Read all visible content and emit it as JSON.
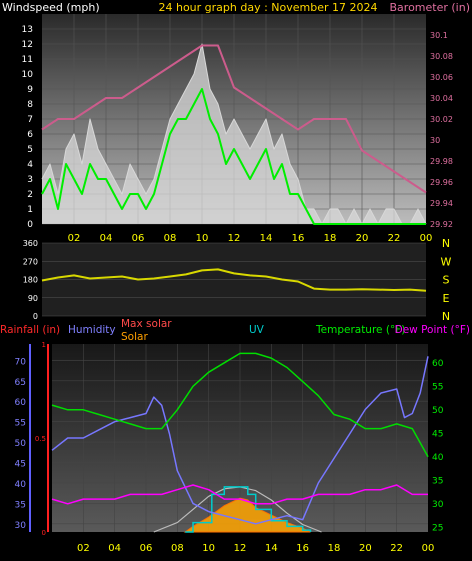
{
  "header": {
    "windspeed_label": "Windspeed (mph)",
    "title": "24 hour graph day : November 17 2024",
    "barometer_label": "Barometer (in)"
  },
  "bottom_header": {
    "rainfall": "Rainfall (in)",
    "humidity": "Humidity",
    "max_solar": "Max solar",
    "solar": "Solar",
    "uv": "UV",
    "temperature": "Temperature (°F)",
    "dew_point": "Dew Point (°F)"
  },
  "colors": {
    "windspeed": "#d8d8d8",
    "gust": "#00ee00",
    "barometer": "#cc5c8c",
    "direction": "#d8d800",
    "rainfall": "#ff2020",
    "humidity": "#7777ff",
    "temperature": "#00dd00",
    "dew_point": "#ff00ff",
    "max_solar": "#bbbbbb",
    "solar": "#ffa500",
    "uv": "#00cccc",
    "left_axis": "#ffff00",
    "compass": "#ffff00"
  },
  "chart_data": [
    {
      "type": "line",
      "title": "24 hour graph day : November 17 2024",
      "x_ticks": [
        "02",
        "04",
        "06",
        "08",
        "10",
        "12",
        "14",
        "16",
        "18",
        "20",
        "22",
        "00"
      ],
      "xlim": [
        0,
        24
      ],
      "left_axis": {
        "label": "Windspeed (mph)",
        "ylim": [
          0,
          14
        ],
        "ticks": [
          "0",
          "1",
          "2",
          "3",
          "4",
          "5",
          "6",
          "7",
          "8",
          "9",
          "10",
          "11",
          "12",
          "13"
        ]
      },
      "right_axis": {
        "label": "Barometer (in)",
        "ylim": [
          29.92,
          30.12
        ],
        "ticks": [
          "29.92",
          "29.94",
          "29.96",
          "29.98",
          "30",
          "30.02",
          "30.04",
          "30.06",
          "30.08",
          "30.1"
        ]
      },
      "series": [
        {
          "name": "Windspeed",
          "axis": "left",
          "x": [
            0,
            0.5,
            1,
            1.5,
            2,
            2.5,
            3,
            3.5,
            4,
            4.5,
            5,
            5.5,
            6,
            6.5,
            7,
            7.5,
            8,
            8.5,
            9,
            9.5,
            10,
            10.5,
            11,
            11.5,
            12,
            12.5,
            13,
            13.5,
            14,
            14.5,
            15,
            15.5,
            16,
            16.5,
            17,
            17.5,
            18,
            18.5,
            19,
            19.5,
            20,
            20.5,
            21,
            21.5,
            22,
            22.5,
            23,
            23.5,
            24
          ],
          "values": [
            3,
            4,
            2,
            5,
            6,
            4,
            7,
            5,
            4,
            3,
            2,
            4,
            3,
            2,
            3,
            5,
            7,
            8,
            9,
            10,
            12,
            9,
            8,
            6,
            7,
            6,
            5,
            6,
            7,
            5,
            6,
            4,
            3,
            1,
            1,
            0,
            1,
            1,
            0,
            1,
            0,
            1,
            0,
            1,
            1,
            0,
            0,
            1,
            0
          ]
        },
        {
          "name": "Gust",
          "axis": "left",
          "x": [
            0,
            0.5,
            1,
            1.5,
            2,
            2.5,
            3,
            3.5,
            4,
            4.5,
            5,
            5.5,
            6,
            6.5,
            7,
            7.5,
            8,
            8.5,
            9,
            9.5,
            10,
            10.5,
            11,
            11.5,
            12,
            12.5,
            13,
            13.5,
            14,
            14.5,
            15,
            15.5,
            16,
            16.5,
            17,
            17.5,
            18,
            18.5,
            19,
            19.5,
            20,
            20.5,
            21,
            21.5,
            22,
            22.5,
            23,
            23.5,
            24
          ],
          "values": [
            2,
            3,
            1,
            4,
            3,
            2,
            4,
            3,
            3,
            2,
            1,
            2,
            2,
            1,
            2,
            4,
            6,
            7,
            7,
            8,
            9,
            7,
            6,
            4,
            5,
            4,
            3,
            4,
            5,
            3,
            4,
            2,
            2,
            1,
            0,
            0,
            0,
            0,
            0,
            0,
            0,
            0,
            0,
            0,
            0,
            0,
            0,
            0,
            0
          ]
        },
        {
          "name": "Barometer",
          "axis": "right",
          "x": [
            0,
            1,
            2,
            3,
            4,
            5,
            6,
            7,
            8,
            9,
            10,
            11,
            12,
            13,
            14,
            15,
            16,
            17,
            18,
            19,
            20,
            21,
            22,
            23,
            24
          ],
          "values": [
            30.01,
            30.02,
            30.02,
            30.03,
            30.04,
            30.04,
            30.05,
            30.06,
            30.07,
            30.08,
            30.09,
            30.09,
            30.05,
            30.04,
            30.03,
            30.02,
            30.01,
            30.02,
            30.02,
            30.02,
            29.99,
            29.98,
            29.97,
            29.96,
            29.95
          ]
        }
      ]
    },
    {
      "type": "line",
      "x_ticks": [
        "02",
        "04",
        "06",
        "08",
        "10",
        "12",
        "14",
        "16",
        "18",
        "20",
        "22",
        "00"
      ],
      "xlim": [
        0,
        24
      ],
      "left_axis": {
        "ylim": [
          0,
          360
        ],
        "ticks": [
          "360",
          "270",
          "180",
          "90",
          "0"
        ]
      },
      "right_labels": [
        "N",
        "W",
        "S",
        "E",
        "N"
      ],
      "series": [
        {
          "name": "Wind direction",
          "x": [
            0,
            1,
            2,
            3,
            4,
            5,
            6,
            7,
            8,
            9,
            10,
            11,
            12,
            13,
            14,
            15,
            16,
            17,
            18,
            19,
            20,
            21,
            22,
            23,
            24
          ],
          "values": [
            175,
            190,
            200,
            185,
            190,
            195,
            180,
            185,
            195,
            205,
            225,
            230,
            210,
            200,
            195,
            180,
            170,
            135,
            130,
            130,
            132,
            130,
            128,
            130,
            125
          ]
        }
      ]
    },
    {
      "type": "line",
      "x_ticks": [
        "02",
        "04",
        "06",
        "08",
        "10",
        "12",
        "14",
        "16",
        "18",
        "20",
        "22",
        "00"
      ],
      "xlim": [
        0,
        24
      ],
      "left_axis": {
        "label": "Humidity",
        "ylim": [
          28,
          74
        ],
        "ticks": [
          "70",
          "65",
          "60",
          "55",
          "50",
          "45",
          "40",
          "35",
          "30"
        ]
      },
      "rain_axis": {
        "label": "Rainfall (in)",
        "ylim": [
          0,
          1
        ],
        "ticks": [
          "1",
          "0.5",
          "0"
        ]
      },
      "right_axis": {
        "label": "Temperature (°F)",
        "ylim": [
          24,
          64
        ],
        "ticks": [
          "60",
          "55",
          "50",
          "45",
          "40",
          "35",
          "30",
          "25"
        ]
      },
      "series": [
        {
          "name": "Humidity",
          "axis": "left",
          "x": [
            0,
            1,
            2,
            3,
            4,
            5,
            6,
            6.5,
            7,
            7.5,
            8,
            9,
            10,
            11,
            12,
            13,
            14,
            15,
            16,
            17,
            18,
            19,
            20,
            21,
            22,
            22.5,
            23,
            23.5,
            24
          ],
          "values": [
            48,
            51,
            51,
            53,
            55,
            56,
            57,
            61,
            59,
            52,
            43,
            35,
            33,
            32,
            31,
            30,
            31,
            32,
            31,
            40,
            46,
            52,
            58,
            62,
            63,
            56,
            57,
            62,
            71
          ]
        },
        {
          "name": "Temperature",
          "axis": "right",
          "x": [
            0,
            1,
            2,
            3,
            4,
            5,
            6,
            7,
            8,
            9,
            10,
            11,
            12,
            13,
            14,
            15,
            16,
            17,
            18,
            19,
            20,
            21,
            22,
            23,
            24
          ],
          "values": [
            51,
            50,
            50,
            49,
            48,
            47,
            46,
            46,
            50,
            55,
            58,
            60,
            62,
            62,
            61,
            59,
            56,
            53,
            49,
            48,
            46,
            46,
            47,
            46,
            40
          ]
        },
        {
          "name": "Dew Point",
          "axis": "right",
          "x": [
            0,
            1,
            2,
            3,
            4,
            5,
            6,
            7,
            8,
            9,
            10,
            11,
            12,
            13,
            14,
            15,
            16,
            17,
            18,
            19,
            20,
            21,
            22,
            23,
            24
          ],
          "values": [
            31,
            30,
            31,
            31,
            31,
            32,
            32,
            32,
            33,
            34,
            33,
            31,
            31,
            30,
            30,
            31,
            31,
            32,
            32,
            32,
            33,
            33,
            34,
            32,
            32
          ]
        },
        {
          "name": "Max solar",
          "axis": "rain",
          "x": [
            6.5,
            8,
            9,
            10,
            11,
            12,
            13,
            14,
            15,
            16,
            17.2
          ],
          "values": [
            0,
            0.05,
            0.12,
            0.19,
            0.23,
            0.24,
            0.22,
            0.17,
            0.1,
            0.04,
            0
          ]
        },
        {
          "name": "Solar",
          "axis": "rain",
          "x": [
            8.5,
            9,
            10,
            11,
            12,
            12.5,
            13,
            14,
            15,
            16,
            16.5
          ],
          "values": [
            0,
            0.03,
            0.08,
            0.14,
            0.18,
            0.17,
            0.13,
            0.09,
            0.05,
            0.02,
            0
          ]
        },
        {
          "name": "UV",
          "axis": "rain",
          "x": [
            8.5,
            9,
            10,
            10.2,
            11,
            12,
            12.5,
            13,
            14,
            15,
            16,
            16.5
          ],
          "values": [
            0,
            0.05,
            0.05,
            0.2,
            0.24,
            0.24,
            0.2,
            0.12,
            0.06,
            0.03,
            0.01,
            0
          ]
        }
      ]
    }
  ]
}
